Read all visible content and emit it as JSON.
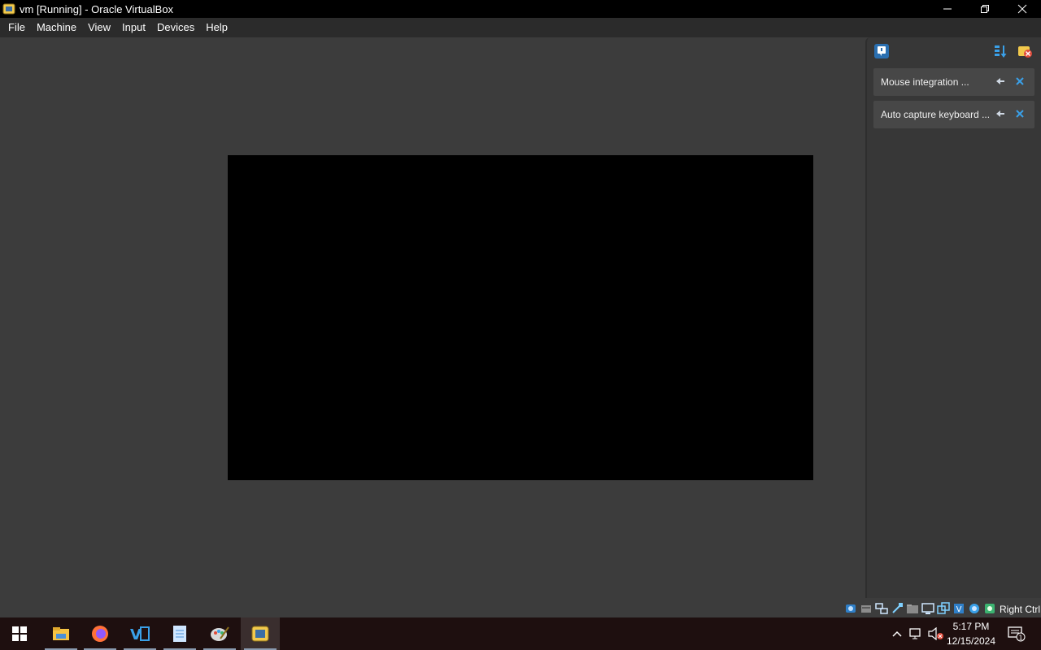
{
  "window": {
    "title": "vm [Running] - Oracle VirtualBox",
    "app_icon": "virtualbox-icon",
    "controls": [
      "minimize-icon",
      "restore-icon",
      "close-icon"
    ]
  },
  "menubar": {
    "items": [
      "File",
      "Machine",
      "View",
      "Input",
      "Devices",
      "Help"
    ]
  },
  "notification_center": {
    "toolbar_icons": [
      "notification-center-icon",
      "sort-icon",
      "dismiss-all-icon"
    ],
    "notices": [
      {
        "label": "Mouse integration ...",
        "icons": [
          "pin-icon",
          "close-icon"
        ]
      },
      {
        "label": "Auto capture keyboard ...",
        "icons": [
          "pin-icon",
          "close-icon"
        ]
      }
    ]
  },
  "statusbar": {
    "icons": [
      "hard-disk-icon",
      "optical-drive-icon",
      "network-icon",
      "usb-icon",
      "shared-folders-icon",
      "display-icon",
      "video-capture-icon",
      "cpu-icon",
      "mouse-integration-icon",
      "keyboard-capture-icon"
    ],
    "host_key": "Right Ctrl"
  },
  "taskbar": {
    "apps": [
      "file-explorer-icon",
      "firefox-icon",
      "visual-studio-icon",
      "notepad-icon",
      "paint-icon",
      "virtualbox-icon"
    ],
    "active_app": "virtualbox-icon",
    "tray": [
      "show-hidden-icons-icon",
      "network-icon",
      "volume-muted-icon"
    ],
    "time": "5:17 PM",
    "date": "12/15/2024",
    "notifications_count": "1"
  },
  "colors": {
    "titlebar": "#000000",
    "menubar": "#2b2b2b",
    "vm_background": "#3c3c3c",
    "vm_screen": "#000000",
    "taskbar": "#1e0f0f",
    "accent_blue": "#3aa0e8"
  }
}
